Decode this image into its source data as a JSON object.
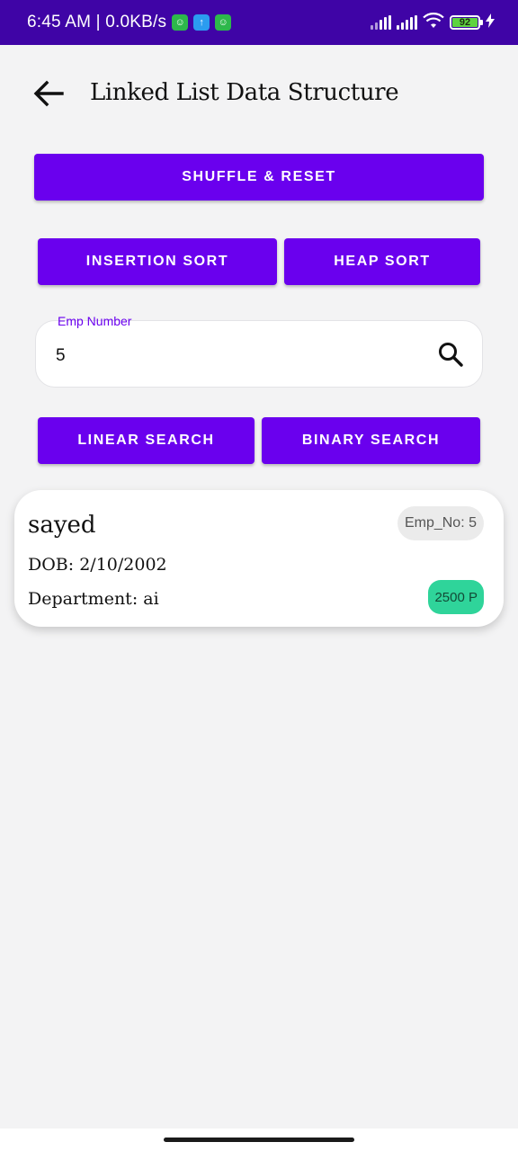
{
  "status_bar": {
    "time": "6:45 AM | 0.0KB/s",
    "battery_level": "92",
    "notification_icons": [
      "robot-icon",
      "upload-icon",
      "robot-icon"
    ],
    "bg_color": "#3f04a6"
  },
  "app_bar": {
    "title": "Linked List Data Structure",
    "back_icon": "arrow-left-icon"
  },
  "buttons": {
    "shuffle_reset": "SHUFFLE & RESET",
    "insertion_sort": "INSERTION SORT",
    "heap_sort": "HEAP SORT",
    "linear_search": "LINEAR SEARCH",
    "binary_search": "BINARY SEARCH",
    "color": "#6a00ee"
  },
  "search_field": {
    "label": "Emp Number",
    "value": "5",
    "icon": "search-icon"
  },
  "result_card": {
    "name": "sayed",
    "dob": "DOB: 2/10/2002",
    "department": "Department: ai",
    "emp_no": "Emp_No: 5",
    "salary": "2500 P",
    "salary_chip_color": "#2fd49a"
  }
}
